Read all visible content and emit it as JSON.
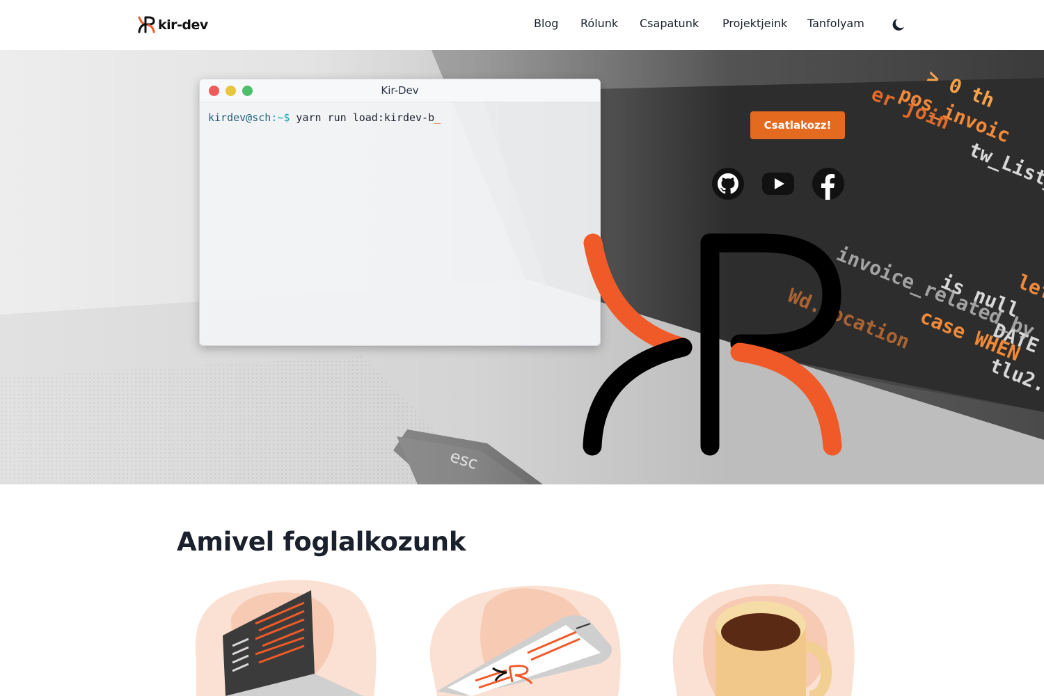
{
  "brand": {
    "name": "kir-dev"
  },
  "nav": {
    "items": [
      "Blog",
      "Rólunk",
      "Csapatunk",
      "Projektjeink",
      "Tanfolyam"
    ]
  },
  "hero": {
    "terminal": {
      "title": "Kir-Dev",
      "prompt_user": "kirdev@sch",
      "prompt_path": ":~$",
      "command": " yarn run load:kirdev-b",
      "cursor": "_"
    },
    "join_button": "Csatlakozz!",
    "background_code_lines": [
      "> 0 th",
      "pos_invoic",
      "er join",
      "tw_List_v",
      "is null",
      "case WHEN",
      "DATE",
      "tlu2.",
      "left",
      "esc"
    ]
  },
  "colors": {
    "accent": "#e36a1e",
    "logo_orange": "#f05a28",
    "dark": "#111111"
  },
  "icons": [
    "kir-dev-logo-icon",
    "moon-icon",
    "github-icon",
    "youtube-icon",
    "facebook-icon"
  ],
  "section": {
    "title": "Amivel foglalkozunk"
  }
}
